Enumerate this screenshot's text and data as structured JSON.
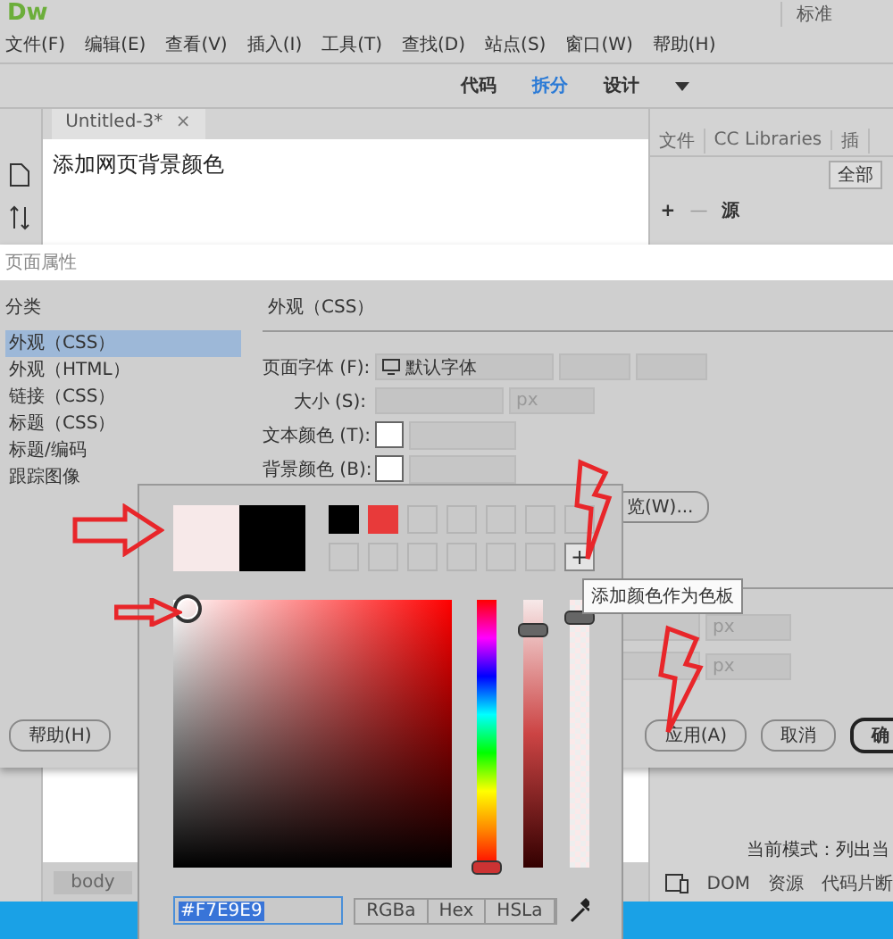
{
  "app": {
    "logo": "Dw",
    "workspace": "标准"
  },
  "menu": [
    "文件(F)",
    "编辑(E)",
    "查看(V)",
    "插入(I)",
    "工具(T)",
    "查找(D)",
    "站点(S)",
    "窗口(W)",
    "帮助(H)"
  ],
  "view_tabs": [
    {
      "label": "代码",
      "selected": false
    },
    {
      "label": "拆分",
      "selected": true
    },
    {
      "label": "设计",
      "selected": false
    }
  ],
  "document": {
    "tab": "Untitled-3*",
    "close": "×",
    "content": "添加网页背景颜色",
    "tag": "body"
  },
  "panel": {
    "tabs": [
      "文件",
      "CC Libraries",
      "插"
    ],
    "filter": "全部",
    "add": "+",
    "remove": "—",
    "source": "源",
    "mode_text": "当前模式：列出当",
    "bottom_tabs": [
      "DOM",
      "资源",
      "代码片断"
    ]
  },
  "dialog": {
    "title": "页面属性",
    "category_label": "分类",
    "categories": [
      {
        "label": "外观（CSS）",
        "selected": true
      },
      {
        "label": "外观（HTML）",
        "selected": false
      },
      {
        "label": "链接（CSS）",
        "selected": false
      },
      {
        "label": "标题（CSS）",
        "selected": false
      },
      {
        "label": "标题/编码",
        "selected": false
      },
      {
        "label": "跟踪图像",
        "selected": false
      }
    ],
    "section": "外观（CSS）",
    "font_label": "页面字体 (F):",
    "font_value": "默认字体",
    "size_label": "大小 (S):",
    "size_unit": "px",
    "text_color_label": "文本颜色 (T):",
    "bg_color_label": "背景颜色 (B):",
    "browse": "览(W)...",
    "units": [
      "px",
      "px"
    ],
    "buttons": [
      {
        "label": "帮助(H)",
        "kind": "help"
      },
      {
        "label": "应用(A)",
        "kind": "normal"
      },
      {
        "label": "取消",
        "kind": "normal"
      },
      {
        "label": "确",
        "kind": "default"
      }
    ]
  },
  "color_picker": {
    "preview": [
      {
        "color": "#f7e9e9"
      },
      {
        "color": "#000000"
      }
    ],
    "swatches": [
      {
        "kind": "color",
        "color": "#000000"
      },
      {
        "kind": "color",
        "color": "#e83a3a"
      },
      {
        "kind": "empty"
      },
      {
        "kind": "empty"
      },
      {
        "kind": "empty"
      },
      {
        "kind": "empty"
      },
      {
        "kind": "empty"
      },
      {
        "kind": "empty"
      },
      {
        "kind": "empty"
      },
      {
        "kind": "empty"
      },
      {
        "kind": "empty"
      },
      {
        "kind": "empty"
      },
      {
        "kind": "empty"
      },
      {
        "kind": "add",
        "label": "+"
      }
    ],
    "hue_slider": {
      "level": 0
    },
    "shade_slider": {
      "level": 0.95
    },
    "alpha_slider": {
      "level": 1
    },
    "hex_value": "#F7E9E9",
    "modes": [
      "RGBa",
      "Hex",
      "HSLa"
    ],
    "tooltip": "添加颜色作为色板"
  }
}
